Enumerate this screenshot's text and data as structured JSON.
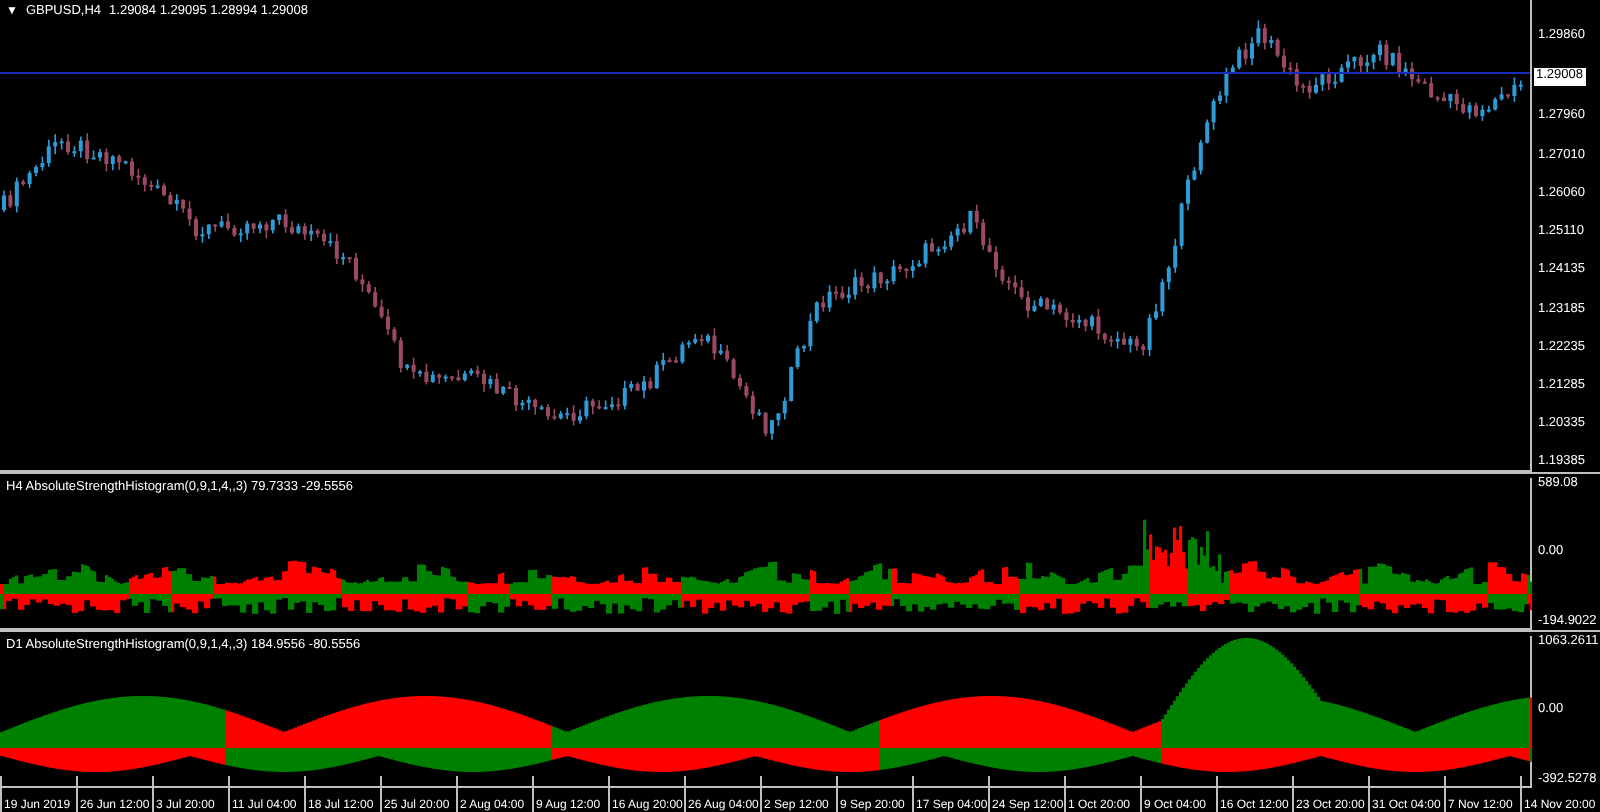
{
  "main_chart": {
    "toggle": "▼",
    "symbol": "GBPUSD,H4",
    "quotes": "1.29084 1.29095 1.28994 1.29008",
    "current_price": "1.29008",
    "price_axis": [
      "1.29860",
      "1.27960",
      "1.27010",
      "1.26060",
      "1.25110",
      "1.24135",
      "1.23185",
      "1.22235",
      "1.21285",
      "1.20335",
      "1.19385"
    ]
  },
  "indicators": [
    {
      "title": "H4 AbsoluteStrengthHistogram(0,9,1,4,,3) 79.7333 -29.5556",
      "axis": [
        "589.08",
        "0.00",
        "-194.9022"
      ],
      "kind": "h4"
    },
    {
      "title": "D1 AbsoluteStrengthHistogram(0,9,1,4,,3) 184.9556 -80.5556",
      "axis": [
        "1063.2611",
        "0.00",
        "-392.5278"
      ],
      "kind": "d1"
    }
  ],
  "time_axis": [
    "19 Jun 2019",
    "26 Jun 12:00",
    "3 Jul 20:00",
    "11 Jul 04:00",
    "18 Jul 12:00",
    "25 Jul 20:00",
    "2 Aug 04:00",
    "9 Aug 12:00",
    "16 Aug 20:00",
    "26 Aug 04:00",
    "2 Sep 12:00",
    "9 Sep 20:00",
    "17 Sep 04:00",
    "24 Sep 12:00",
    "1 Oct 20:00",
    "9 Oct 04:00",
    "16 Oct 12:00",
    "23 Oct 20:00",
    "31 Oct 04:00",
    "7 Nov 12:00",
    "14 Nov 20:00"
  ]
}
